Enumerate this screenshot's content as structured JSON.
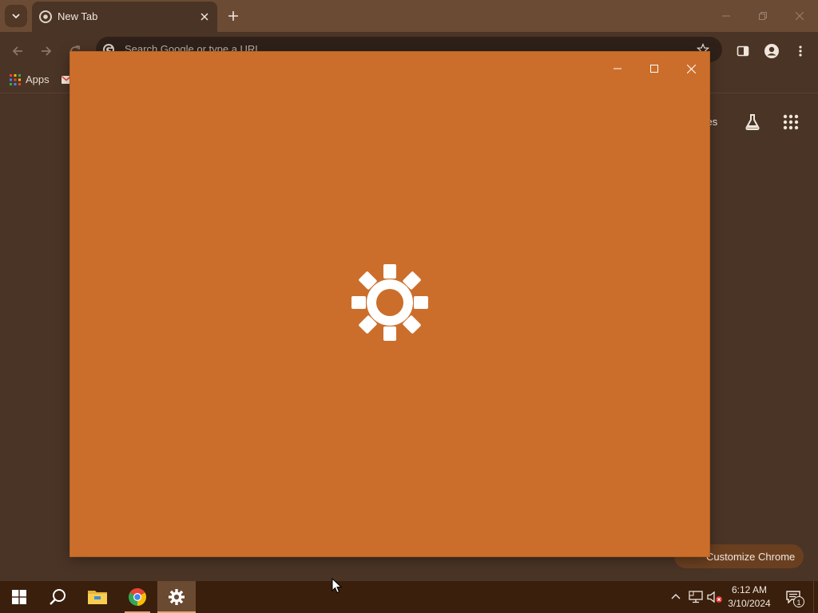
{
  "browser": {
    "tab_title": "New Tab",
    "omnibox_placeholder": "Search Google or type a URL",
    "bookmarks": [
      {
        "label": "Apps"
      }
    ],
    "ntp": {
      "images_link": "ages",
      "customize_label": "Customize Chrome"
    }
  },
  "settings_window": {
    "background": "#cc6e2b",
    "splash_icon": "gear-icon"
  },
  "taskbar": {
    "apps": [
      "start-icon",
      "search-icon",
      "file-explorer-icon",
      "chrome-icon",
      "settings-icon"
    ],
    "clock": {
      "time": "6:12 AM",
      "date": "3/10/2024"
    },
    "notification_count": "1"
  },
  "colors": {
    "chrome_frame": "#6b4b33",
    "chrome_body": "#4a3426",
    "taskbar": "#3a1f0d",
    "settings_accent": "#cc6e2b"
  }
}
